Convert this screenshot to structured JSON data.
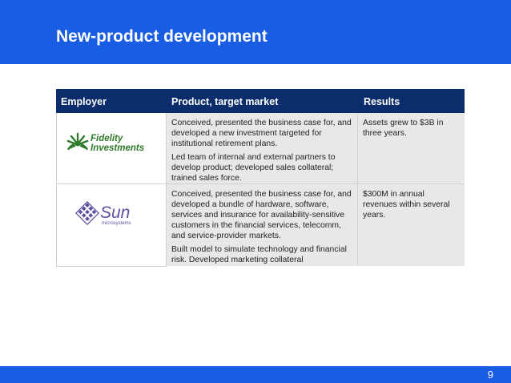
{
  "slide": {
    "title": "New-product development",
    "page_number": "9"
  },
  "table": {
    "headers": [
      "Employer",
      "Product, target market",
      "Results"
    ],
    "rows": [
      {
        "employer_logo_text": [
          "Fidelity",
          "Investments"
        ],
        "product": [
          "Conceived, presented the business case for, and developed a new investment targeted for institutional retirement plans.",
          "Led team of internal and external partners to develop product; developed sales collateral; trained sales force."
        ],
        "results": "Assets grew to $3B in three years."
      },
      {
        "employer_logo_text": [
          "Sun",
          "microsystems"
        ],
        "product": [
          "Conceived, presented the business case for, and developed a bundle of hardware, software, services and insurance for availability-sensitive customers in the financial services, telecomm, and service-provider markets.",
          "Built model to simulate technology and financial risk. Developed marketing collateral"
        ],
        "results": "$300M in annual revenues within several years."
      }
    ]
  },
  "colors": {
    "header_blue": "#1a5de5",
    "table_header_navy": "#0b2d6b",
    "row_gray": "#e8e8e8",
    "fidelity_green": "#2f7a2a",
    "sun_purple": "#5c4f9e"
  }
}
